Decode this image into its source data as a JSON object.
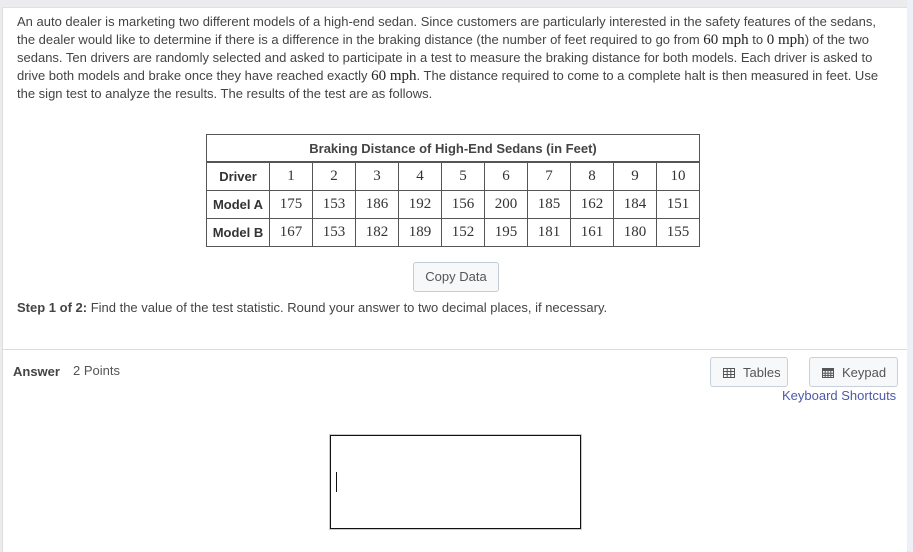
{
  "problem": {
    "text_1": "An auto dealer is marketing two different models of a high-end sedan. Since customers are particularly interested in the safety features of the sedans, the dealer would like to determine if there is a difference in the braking distance (the number of feet required to go from ",
    "speed_from": "60 mph",
    "text_2": " to ",
    "speed_to": "0 mph",
    "text_3": ") of the two sedans. Ten drivers are randomly selected and asked to participate in a test to measure the braking distance for both models. Each driver is asked to drive both models and brake once they have reached exactly ",
    "speed_exact": "60 mph",
    "text_4": ". The distance required to come to a complete halt is then measured in feet. Use the sign test to analyze the results. The results of the test are as follows."
  },
  "table": {
    "caption": "Braking Distance of High-End Sedans (in Feet)",
    "header_label": "Driver",
    "drivers": [
      "1",
      "2",
      "3",
      "4",
      "5",
      "6",
      "7",
      "8",
      "9",
      "10"
    ],
    "rows": [
      {
        "label": "Model A",
        "values": [
          "175",
          "153",
          "186",
          "192",
          "156",
          "200",
          "185",
          "162",
          "184",
          "151"
        ]
      },
      {
        "label": "Model B",
        "values": [
          "167",
          "153",
          "182",
          "189",
          "152",
          "195",
          "181",
          "161",
          "180",
          "155"
        ]
      }
    ]
  },
  "copy_button": "Copy Data",
  "step": {
    "prefix": "Step 1 of 2:",
    "text": " Find the value of the test statistic. Round your answer to two decimal places, if necessary."
  },
  "answer": {
    "label": "Answer",
    "points": "2 Points",
    "value": ""
  },
  "toolbar": {
    "tables_label": "Tables",
    "keypad_label": "Keypad",
    "shortcuts_label": "Keyboard Shortcuts"
  }
}
